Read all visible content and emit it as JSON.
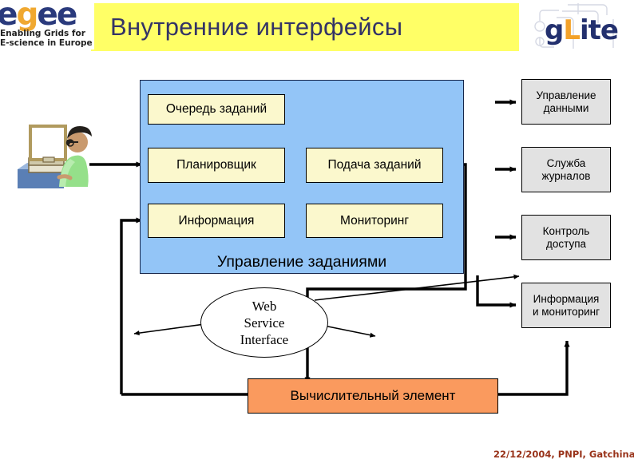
{
  "slide": {
    "title": "Внутренние интерфейсы",
    "footer": "22/12/2004, PNPI, Gatchina",
    "banner_color": "#ffff66",
    "title_color": "#333366"
  },
  "logos": {
    "egee": {
      "wordmark_e1": "e",
      "wordmark_g": "g",
      "wordmark_e2": "e",
      "wordmark_e3": "e",
      "tagline_line1": "Enabling Grids for",
      "tagline_line2": "E-science in Europe",
      "blue": "#2a3a7c",
      "orange": "#f0a830"
    },
    "glite": {
      "text_g": "g",
      "text_l": "L",
      "text_ite": "ite",
      "blue": "#23306e",
      "orange": "#f3a22a"
    }
  },
  "diagram": {
    "job_management": {
      "panel_label": "Управление заданиями",
      "panel_color": "#93c5f7",
      "boxes": [
        {
          "id": "job-queue",
          "label": "Очередь заданий"
        },
        {
          "id": "scheduler",
          "label": "Планировщик"
        },
        {
          "id": "job-submission",
          "label": "Подача заданий"
        },
        {
          "id": "information",
          "label": "Информация"
        },
        {
          "id": "monitoring",
          "label": "Мониторинг"
        }
      ],
      "box_color": "#fbf8cd"
    },
    "services": {
      "color": "#e2e2e2",
      "boxes": [
        {
          "id": "data-management",
          "line1": "Управление",
          "line2": "данными"
        },
        {
          "id": "logging-service",
          "line1": "Служба",
          "line2": "журналов"
        },
        {
          "id": "access-control",
          "line1": "Контроль",
          "line2": "доступа"
        },
        {
          "id": "info-monitoring",
          "line1": "Информация",
          "line2": "и мониторинг"
        }
      ]
    },
    "web_service_interface": {
      "line1": "Web",
      "line2": "Service",
      "line3": "Interface"
    },
    "computing_element": {
      "label": "Вычислительный элемент",
      "color": "#fa9a5e"
    },
    "user_clipart": "user-at-computer-icon"
  }
}
